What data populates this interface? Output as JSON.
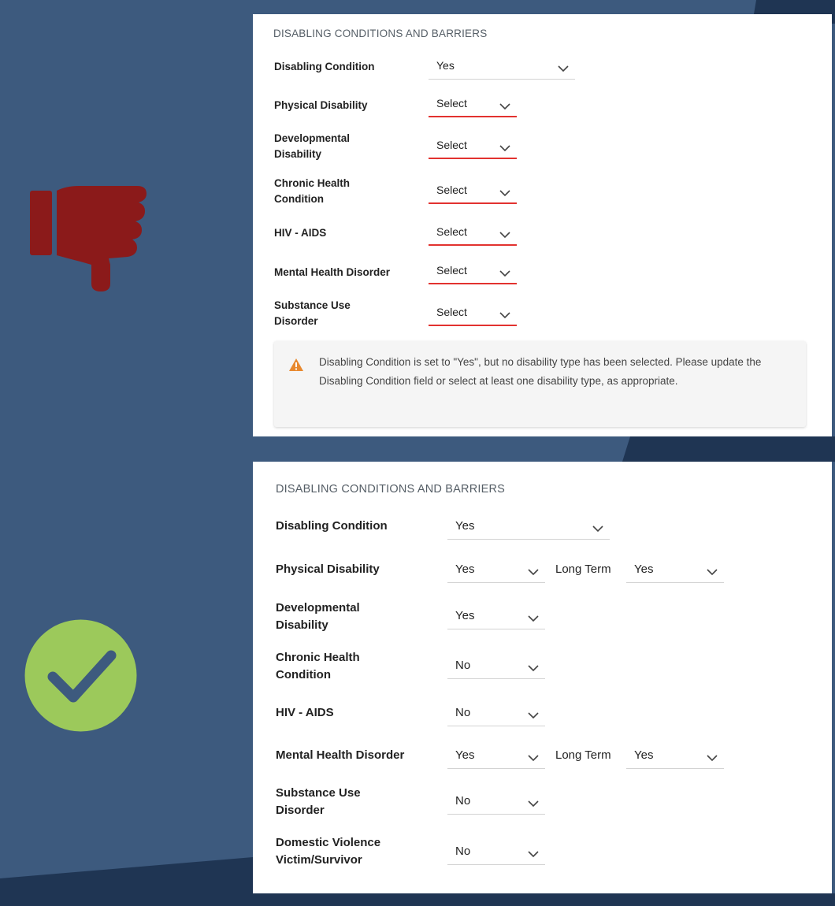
{
  "colors": {
    "background": "#3d5a7e",
    "background_dark": "#1f3553",
    "error_underline": "#e2322f",
    "thumbs_down": "#8b1a1a",
    "check_circle": "#9cc95b",
    "check_mark": "#3d5a7e",
    "warning": "#e8892f"
  },
  "icons": {
    "thumbs_down": "thumbs-down-icon",
    "check": "check-circle-icon",
    "chevron": "chevron-down-icon",
    "warning": "warning-icon"
  },
  "bad_example": {
    "section_title": "DISABLING CONDITIONS AND BARRIERS",
    "rows": [
      {
        "label": "Disabling Condition",
        "value": "Yes"
      },
      {
        "label": "Physical Disability",
        "value": "Select"
      },
      {
        "label": "Developmental Disability",
        "value": "Select"
      },
      {
        "label": "Chronic Health Condition",
        "value": "Select"
      },
      {
        "label": "HIV - AIDS",
        "value": "Select"
      },
      {
        "label": "Mental Health Disorder",
        "value": "Select"
      },
      {
        "label": "Substance Use Disorder",
        "value": "Select"
      }
    ],
    "alert": "Disabling Condition is set to \"Yes\", but no disability type has been selected. Please update the Disabling Condition field or select at least one disability type, as appropriate."
  },
  "good_example": {
    "section_title": "DISABLING CONDITIONS AND BARRIERS",
    "rows": [
      {
        "label": "Disabling Condition",
        "value": "Yes"
      },
      {
        "label": "Physical Disability",
        "value": "Yes",
        "long_term_label": "Long Term",
        "long_term_value": "Yes"
      },
      {
        "label": "Developmental Disability",
        "value": "Yes"
      },
      {
        "label": "Chronic Health Condition",
        "value": "No"
      },
      {
        "label": "HIV - AIDS",
        "value": "No"
      },
      {
        "label": "Mental Health Disorder",
        "value": "Yes",
        "long_term_label": "Long Term",
        "long_term_value": "Yes"
      },
      {
        "label": "Substance Use Disorder",
        "value": "No"
      },
      {
        "label": "Domestic Violence Victim/Survivor",
        "value": "No"
      }
    ]
  }
}
